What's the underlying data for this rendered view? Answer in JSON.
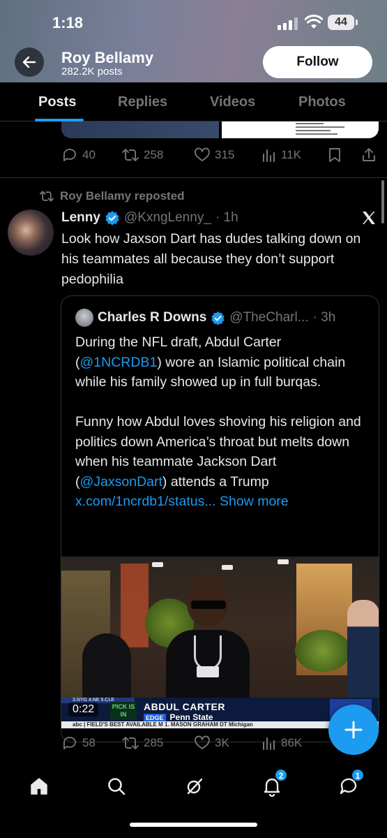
{
  "status_bar": {
    "time": "1:18",
    "battery": "44"
  },
  "profile": {
    "name": "Roy Bellamy",
    "post_count": "282.2K posts",
    "follow_label": "Follow"
  },
  "tabs": [
    {
      "label": "Posts",
      "active": true
    },
    {
      "label": "Replies",
      "active": false
    },
    {
      "label": "Videos",
      "active": false
    },
    {
      "label": "Photos",
      "active": false
    }
  ],
  "prev_post": {
    "replies": "40",
    "reposts": "258",
    "likes": "315",
    "views": "11K"
  },
  "repost": {
    "repost_label": "Roy Bellamy reposted",
    "author_name": "Lenny",
    "author_handle": "@KxngLenny_",
    "time": "· 1h",
    "text": "Look how Jaxson Dart has dudes talking down on his teammates all because they don’t support pedophilia",
    "quote": {
      "author_name": "Charles R Downs",
      "author_handle": "@TheCharl...",
      "time": "· 3h",
      "p1_a": "During the NFL draft, Abdul Carter (",
      "p1_link": "@1NCRDB1",
      "p1_b": ") wore an Islamic political chain while his family showed up in full burqas.",
      "p2_a": "Funny how Abdul loves shoving his religion and politics down America’s throat but melts down when his teammate Jackson Dart (",
      "p2_link": "@JaxsonDart",
      "p2_b": ") attends a Trump ",
      "url": "x.com/1ncrdb1/status...",
      "show_more": "Show more",
      "video": {
        "duration": "0:22",
        "banner_picks": "3.NYG   4.NE   5.CLE",
        "pick_label": "PICK IS IN",
        "player_name": "ABDUL CARTER",
        "position": "EDGE",
        "school": "Penn State",
        "ticker": "abc | FIELD'S BEST AVAILABLE  M  1. MASON GRAHAM  DT  Michigan",
        "team_logo": "NY"
      }
    },
    "replies": "58",
    "reposts": "285",
    "likes": "3K",
    "views": "86K"
  },
  "bottom_nav": {
    "notifications_badge": "2",
    "messages_badge": "1"
  },
  "colors": {
    "accent": "#1d9bf0",
    "muted": "#71767b",
    "text": "#e7e9ea",
    "background": "#000000"
  }
}
